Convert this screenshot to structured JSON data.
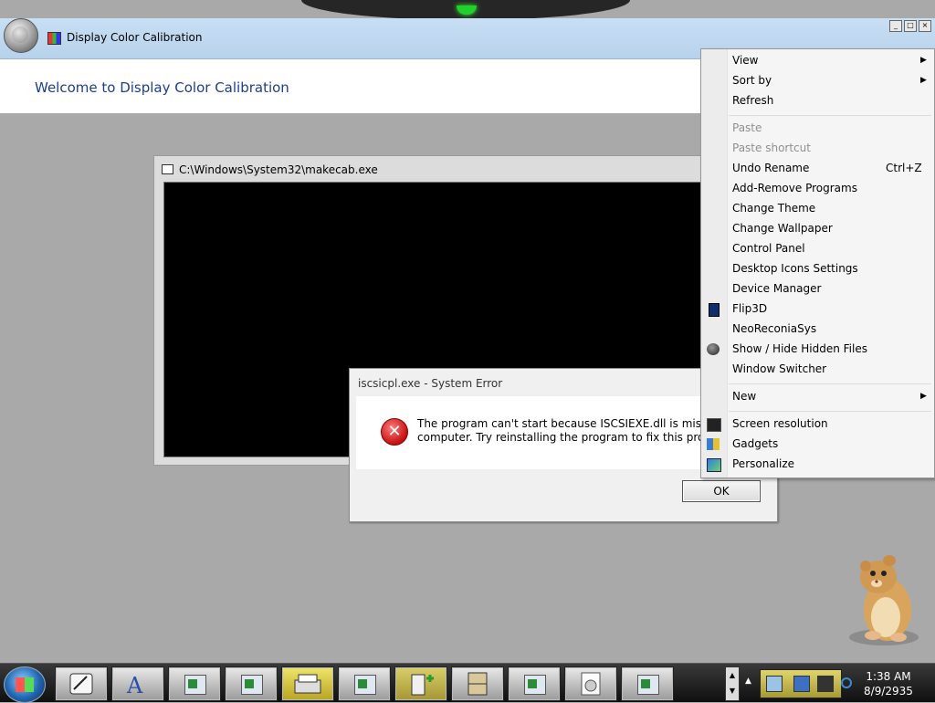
{
  "main_window": {
    "title": "Display Color Calibration",
    "heading": "Welcome to Display Color Calibration"
  },
  "console": {
    "title": "C:\\Windows\\System32\\makecab.exe"
  },
  "error_dialog": {
    "title": "iscsicpl.exe - System Error",
    "message_line1": "The program can't start because ISCSIEXE.dll is missing from",
    "message_line2": "computer. Try reinstalling the program to fix this problem.",
    "ok_label": "OK"
  },
  "context_menu": {
    "items": [
      {
        "label": "View",
        "submenu": true
      },
      {
        "label": "Sort by",
        "submenu": true
      },
      {
        "label": "Refresh"
      },
      {
        "label": "Paste",
        "disabled": true
      },
      {
        "label": "Paste shortcut",
        "disabled": true
      },
      {
        "label": "Undo Rename",
        "shortcut": "Ctrl+Z"
      },
      {
        "label": "Add-Remove Programs"
      },
      {
        "label": "Change Theme"
      },
      {
        "label": "Change Wallpaper"
      },
      {
        "label": "Control Panel"
      },
      {
        "label": "Desktop Icons Settings"
      },
      {
        "label": "Device Manager"
      },
      {
        "label": "Flip3D",
        "icon": "flip3d-icon"
      },
      {
        "label": "NeoReconiaSys"
      },
      {
        "label": "Show / Hide Hidden Files",
        "icon": "hidden-files-icon"
      },
      {
        "label": "Window Switcher"
      },
      {
        "label": "New",
        "submenu": true
      },
      {
        "label": "Screen resolution",
        "icon": "monitor-icon"
      },
      {
        "label": "Gadgets",
        "icon": "gadgets-icon"
      },
      {
        "label": "Personalize",
        "icon": "personalize-icon"
      }
    ]
  },
  "taskbar": {
    "buttons": [
      {
        "icon": "paint-icon"
      },
      {
        "icon": "font-icon"
      },
      {
        "icon": "window-icon"
      },
      {
        "icon": "window-icon"
      },
      {
        "icon": "printer-icon"
      },
      {
        "icon": "window-icon"
      },
      {
        "icon": "add-file-icon"
      },
      {
        "icon": "cabinet-icon"
      },
      {
        "icon": "window-icon"
      },
      {
        "icon": "disc-icon"
      },
      {
        "icon": "window-icon"
      }
    ],
    "time": "1:38 AM",
    "date": "8/9/2935"
  },
  "colors": {
    "desktop": "#a9a9a9",
    "titlebar": "#b7d2ec",
    "heading_text": "#1c3f8a",
    "error_red": "#c41010"
  }
}
